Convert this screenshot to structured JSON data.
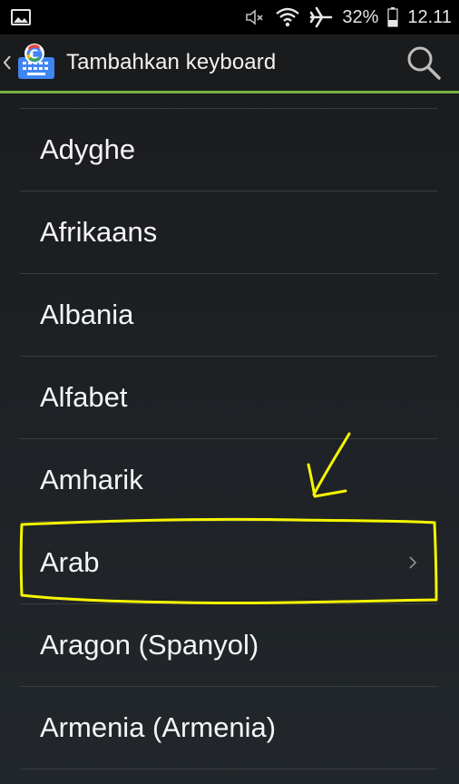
{
  "status_bar": {
    "icons": [
      "image-icon",
      "mute-icon",
      "wifi-icon",
      "airplane-icon",
      "battery-icon"
    ],
    "battery": "32%",
    "clock": "12.11"
  },
  "action_bar": {
    "title": "Tambahkan keyboard",
    "accent_color": "#7cb342"
  },
  "language_list": {
    "items": [
      {
        "label": "Adyghe",
        "has_chevron": false
      },
      {
        "label": "Afrikaans",
        "has_chevron": false
      },
      {
        "label": "Albania",
        "has_chevron": false
      },
      {
        "label": "Alfabet",
        "has_chevron": false
      },
      {
        "label": "Amharik",
        "has_chevron": false
      },
      {
        "label": "Arab",
        "has_chevron": true
      },
      {
        "label": "Aragon (Spanyol)",
        "has_chevron": false
      },
      {
        "label": "Armenia (Armenia)",
        "has_chevron": false
      }
    ]
  },
  "annotation": {
    "color": "#f5f500",
    "highlighted_item": "Arab"
  }
}
